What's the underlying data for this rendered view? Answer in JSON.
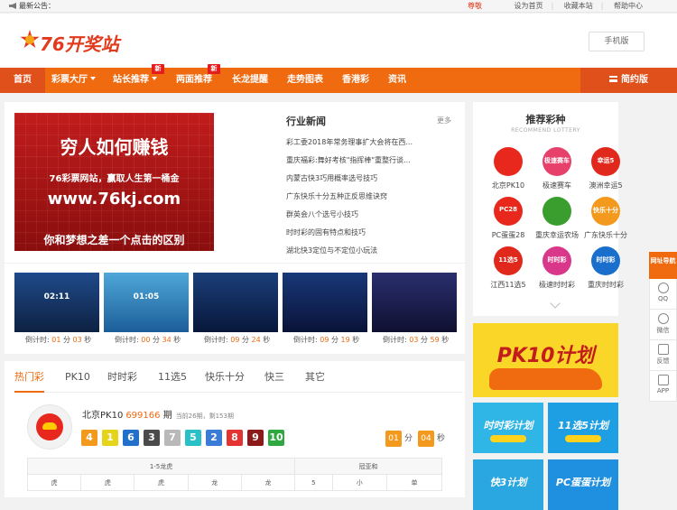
{
  "topbar": {
    "notice_label": "最新公告：",
    "notice_msg": "尊敬",
    "links": [
      "设为首页",
      "收藏本站",
      "帮助中心"
    ]
  },
  "header": {
    "logo_text": "76开奖站",
    "mobile_button": "手机版"
  },
  "nav": {
    "home": "首页",
    "items": [
      {
        "label": "彩票大厅",
        "dropdown": true,
        "badge": ""
      },
      {
        "label": "站长推荐",
        "dropdown": true,
        "badge": "新"
      },
      {
        "label": "两面推荐",
        "dropdown": false,
        "badge": "新"
      },
      {
        "label": "长龙提醒",
        "dropdown": false,
        "badge": ""
      },
      {
        "label": "走势图表",
        "dropdown": false,
        "badge": ""
      },
      {
        "label": "香港彩",
        "dropdown": false,
        "badge": ""
      },
      {
        "label": "资讯",
        "dropdown": false,
        "badge": ""
      }
    ],
    "simple_version": "简约版"
  },
  "banner": {
    "line1": "穷人如何赚钱",
    "line2": "76彩票网站，赢取人生第一桶金",
    "line3": "www.76kj.com",
    "line4": "你和梦想之差一个点击的区别"
  },
  "news": {
    "title": "行业新闻",
    "more": "更多",
    "items": [
      "彩工委2018年常务理事扩大会将在西...",
      "重庆福彩:舞好考核\"指挥棒\"重整行谈...",
      "内蒙古快3巧用概率选号技巧",
      "广东快乐十分五种正反思维诀窍",
      "群英会八个选号小技巧",
      "时时彩的固有特点和技巧",
      "湖北快3定位与不定位小玩法"
    ]
  },
  "games": [
    {
      "scene_time": "02:11",
      "countdown_label": "倒计时:",
      "m": "01",
      "s": "03",
      "colors": [
        "#1f4a8a",
        "#0d2142"
      ]
    },
    {
      "scene_time": "01:05",
      "countdown_label": "倒计时:",
      "m": "00",
      "s": "34",
      "colors": [
        "#4fa7d8",
        "#1b5e99"
      ]
    },
    {
      "scene_time": "",
      "countdown_label": "倒计时:",
      "m": "09",
      "s": "24",
      "colors": [
        "#1b3f7a",
        "#08173a"
      ]
    },
    {
      "scene_time": "",
      "countdown_label": "倒计时:",
      "m": "09",
      "s": "19",
      "colors": [
        "#183878",
        "#0a1338"
      ]
    },
    {
      "scene_time": "",
      "countdown_label": "倒计时:",
      "m": "03",
      "s": "59",
      "colors": [
        "#2a2f6e",
        "#0f1030"
      ]
    }
  ],
  "countdown_units": {
    "min": "分",
    "sec": "秒"
  },
  "tabs": [
    "热门彩",
    "PK10",
    "时时彩",
    "11选5",
    "快乐十分",
    "快三",
    "其它"
  ],
  "lottery": {
    "name": "北京PK10",
    "issue": "699166",
    "issue_suffix": "期",
    "status": "当前26期，剩153期",
    "balls": [
      {
        "n": "4",
        "color": "#f39a1e"
      },
      {
        "n": "1",
        "color": "#e6d41a"
      },
      {
        "n": "6",
        "color": "#2270c9"
      },
      {
        "n": "3",
        "color": "#4b4b4b"
      },
      {
        "n": "7",
        "color": "#b9b9b9"
      },
      {
        "n": "5",
        "color": "#2ac0c8"
      },
      {
        "n": "2",
        "color": "#3a7bd5"
      },
      {
        "n": "8",
        "color": "#e33333"
      },
      {
        "n": "9",
        "color": "#8b1a1a"
      },
      {
        "n": "10",
        "color": "#2fa842"
      }
    ],
    "countdown": {
      "m": "01",
      "m_unit": "分",
      "s": "04",
      "s_unit": "秒"
    },
    "table": {
      "head": [
        "1-5龙虎",
        "冠亚和"
      ],
      "row": [
        "虎",
        "虎",
        "虎",
        "龙",
        "龙",
        "5",
        "小",
        "单"
      ]
    }
  },
  "recommend": {
    "title": "推荐彩种",
    "subtitle": "RECOMMEND LOTTERY",
    "items": [
      {
        "label": "北京PK10",
        "icon": "car-icon",
        "color": "#e8281c",
        "text": ""
      },
      {
        "label": "极速赛车",
        "icon": "speed-car-icon",
        "color": "#e7406b",
        "text": "极速赛车"
      },
      {
        "label": "澳洲幸运5",
        "icon": "lucky5-icon",
        "color": "#e0281c",
        "text": "幸运5"
      },
      {
        "label": "PC蛋蛋28",
        "icon": "pc28-icon",
        "color": "#e8281c",
        "text": "PC28"
      },
      {
        "label": "重庆幸运农场",
        "icon": "farm-icon",
        "color": "#3a9e2e",
        "text": ""
      },
      {
        "label": "广东快乐十分",
        "icon": "happy10-icon",
        "color": "#f39a1e",
        "text": "快乐十分"
      },
      {
        "label": "江西11选5",
        "icon": "11x5-icon",
        "color": "#e0281c",
        "text": "11选5"
      },
      {
        "label": "极速时时彩",
        "icon": "ssc-fast-icon",
        "color": "#d9388a",
        "text": "时时彩"
      },
      {
        "label": "重庆时时彩",
        "icon": "ssc-icon",
        "color": "#1b6fcc",
        "text": "时时彩"
      }
    ]
  },
  "ads": {
    "pk10": "PK10计划",
    "small": [
      {
        "text": "时时彩计划",
        "color": "#2fb6e6"
      },
      {
        "text": "11选5计划",
        "color": "#1e9ee3"
      },
      {
        "text": "快3计划",
        "color": "#2aa6e0"
      },
      {
        "text": "PC蛋蛋计划",
        "color": "#1f8fe0"
      }
    ]
  },
  "float_bar": {
    "first": "网址导航",
    "items": [
      {
        "label": "QQ",
        "icon": "qq-icon"
      },
      {
        "label": "微信",
        "icon": "wechat-icon"
      },
      {
        "label": "反馈",
        "icon": "feedback-icon"
      },
      {
        "label": "APP",
        "icon": "app-icon"
      }
    ]
  }
}
